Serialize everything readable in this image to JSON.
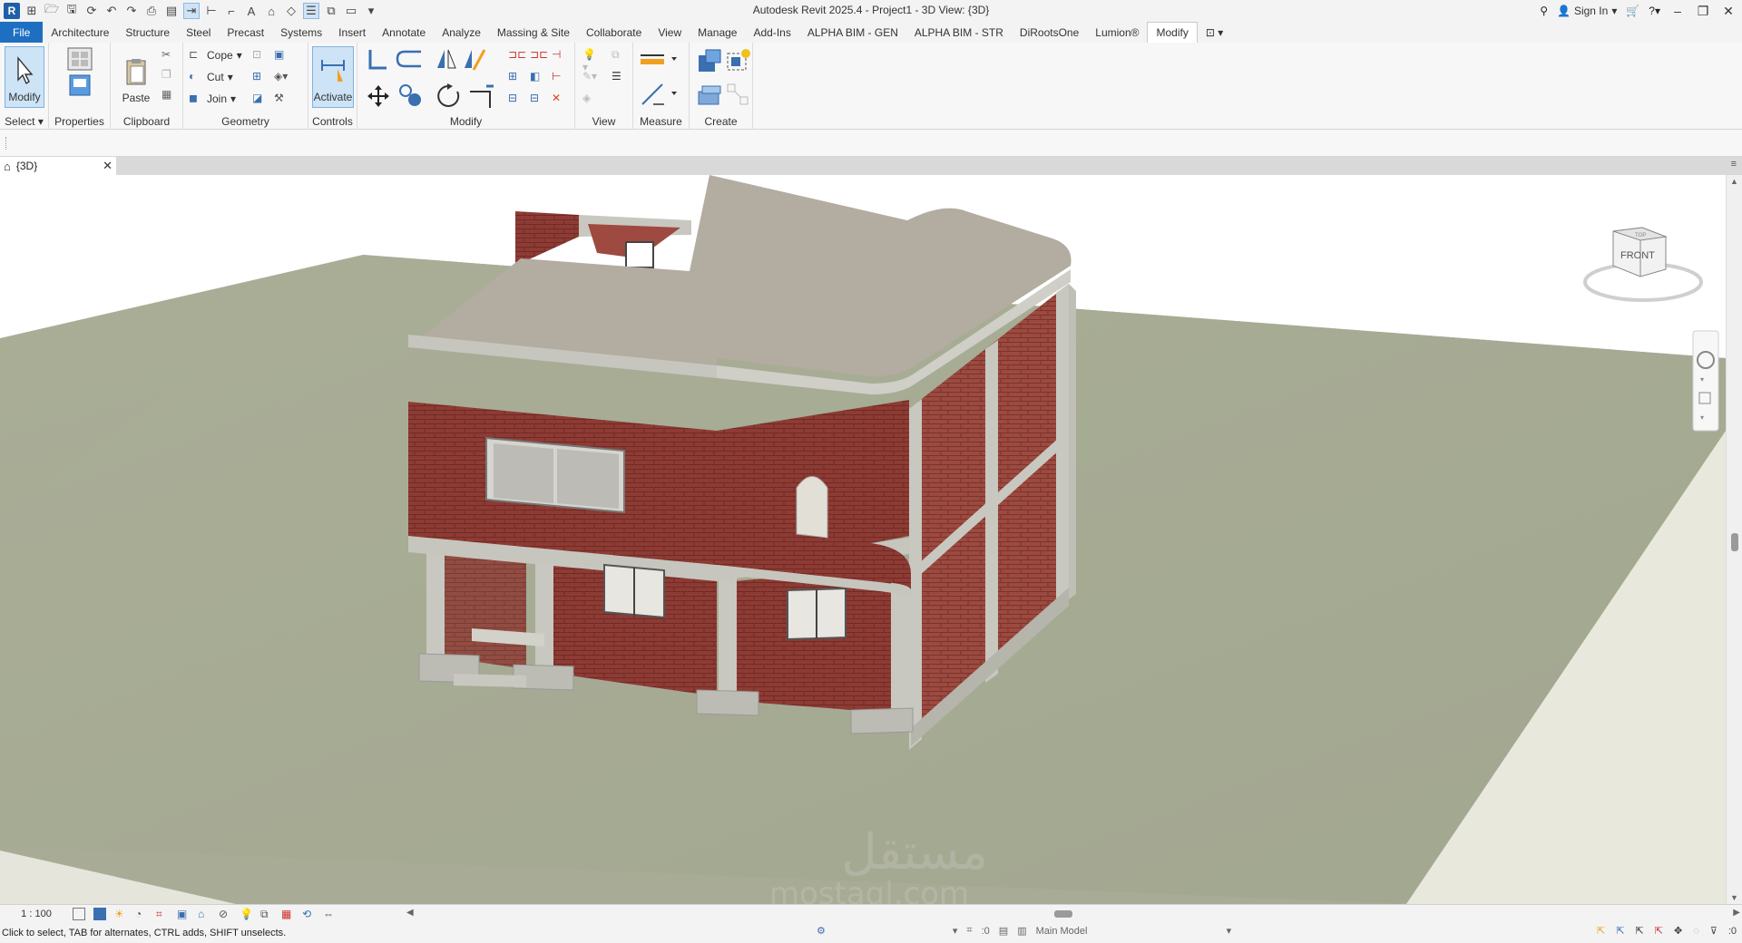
{
  "window": {
    "title": "Autodesk Revit 2025.4 - Project1 - 3D View: {3D}",
    "app_badge": "R",
    "sign_in": "Sign In"
  },
  "tabs": [
    {
      "label": "File"
    },
    {
      "label": "Architecture"
    },
    {
      "label": "Structure"
    },
    {
      "label": "Steel"
    },
    {
      "label": "Precast"
    },
    {
      "label": "Systems"
    },
    {
      "label": "Insert"
    },
    {
      "label": "Annotate"
    },
    {
      "label": "Analyze"
    },
    {
      "label": "Massing & Site"
    },
    {
      "label": "Collaborate"
    },
    {
      "label": "View"
    },
    {
      "label": "Manage"
    },
    {
      "label": "Add-Ins"
    },
    {
      "label": "ALPHA BIM - GEN"
    },
    {
      "label": "ALPHA BIM - STR"
    },
    {
      "label": "DiRootsOne"
    },
    {
      "label": "Lumion®"
    },
    {
      "label": "Modify"
    }
  ],
  "active_tab": "Modify",
  "ribbon": {
    "select": {
      "button": "Modify",
      "title": "Select"
    },
    "properties": {
      "title": "Properties"
    },
    "clipboard": {
      "paste": "Paste",
      "title": "Clipboard"
    },
    "geometry": {
      "cope": "Cope",
      "cut": "Cut",
      "join": "Join",
      "title": "Geometry"
    },
    "controls": {
      "activate": "Activate",
      "title": "Controls"
    },
    "modify": {
      "title": "Modify"
    },
    "view": {
      "title": "View"
    },
    "measure": {
      "title": "Measure"
    },
    "create": {
      "title": "Create"
    }
  },
  "view_tab": {
    "label": "{3D}"
  },
  "viewcube": {
    "face": "FRONT",
    "top": "TOP"
  },
  "view_bar": {
    "scale": "1 : 100"
  },
  "status": {
    "message": "Click to select, TAB for alternates, CTRL adds, SHIFT unselects.",
    "worksets": ":0",
    "model": "Main Model",
    "filter": ":0"
  },
  "watermark": {
    "arabic": "مستقل",
    "latin": "mostaql.com"
  },
  "colors": {
    "file_tab": "#1e6fc1",
    "ground": "#a9ad95",
    "brick": "#8e3b34",
    "roof": "#b3aca1",
    "concrete": "#c6c6be"
  }
}
